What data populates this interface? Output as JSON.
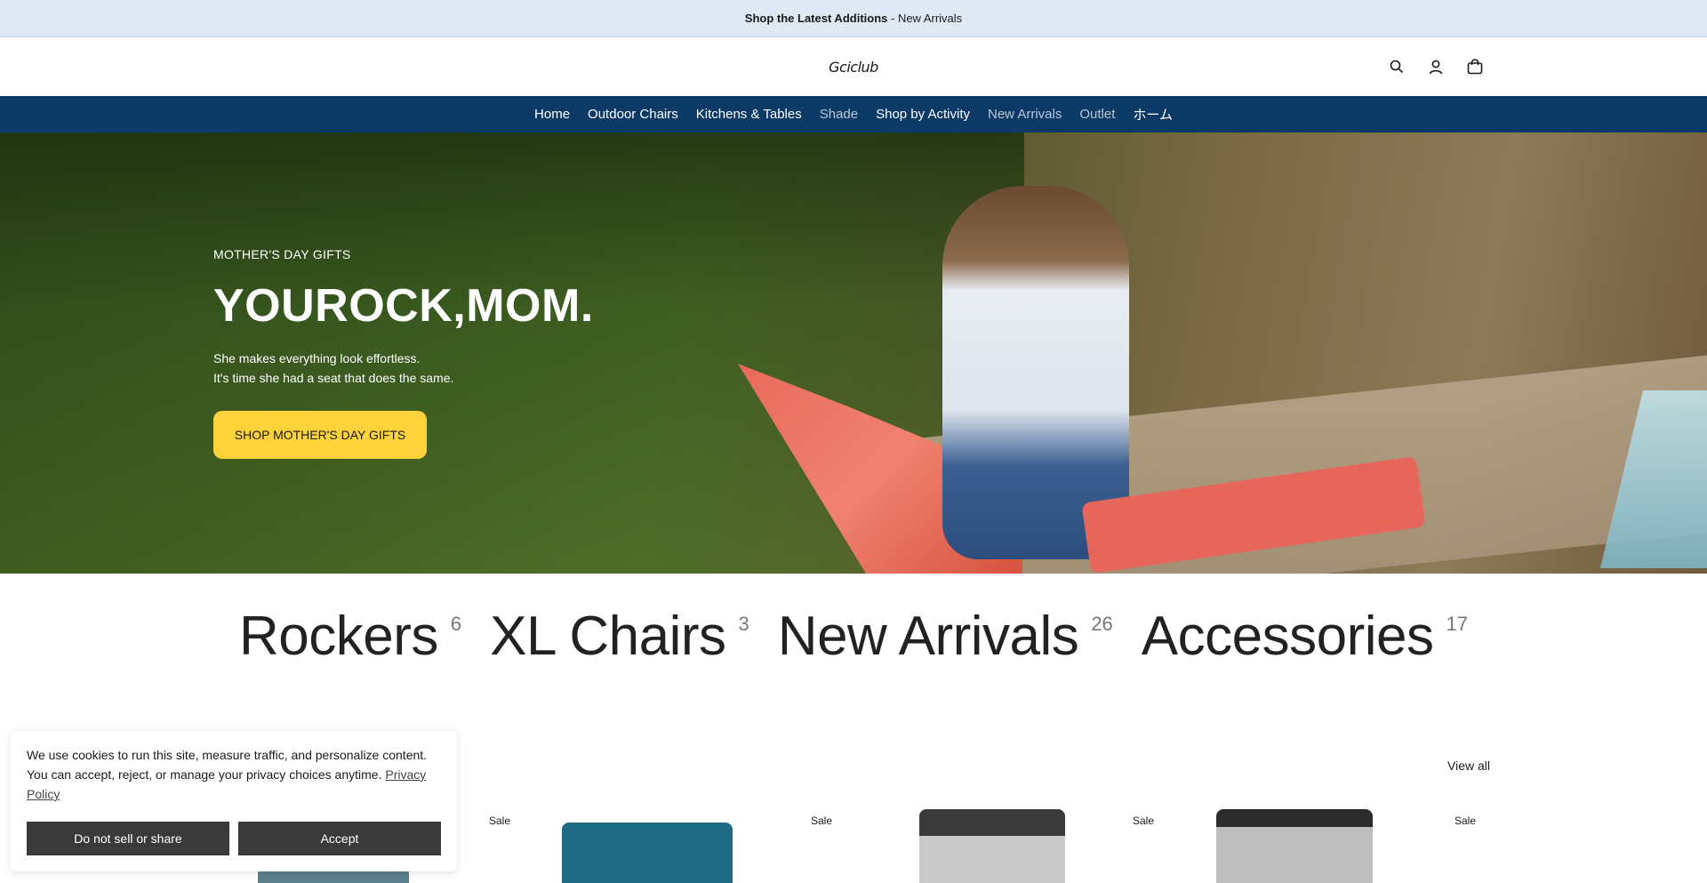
{
  "announcement": {
    "bold": "Shop the Latest Additions",
    "sep": " - ",
    "link": "New Arrivals"
  },
  "header": {
    "logo": "Gciclub",
    "icons": [
      "search-icon",
      "account-icon",
      "cart-icon"
    ]
  },
  "nav": {
    "items": [
      {
        "label": "Home"
      },
      {
        "label": "Outdoor Chairs"
      },
      {
        "label": "Kitchens & Tables"
      },
      {
        "label": "Shade"
      },
      {
        "label": "Shop by Activity"
      },
      {
        "label": "New Arrivals"
      },
      {
        "label": "Outlet"
      },
      {
        "label": "ホーム"
      }
    ]
  },
  "hero": {
    "eyebrow": "MOTHER'S DAY GIFTS",
    "title": "YOUROCK,MOM.",
    "line1": "She makes everything look effortless.",
    "line2": "It's time she had a seat that does the same.",
    "button": "SHOP MOTHER'S DAY GIFTS"
  },
  "categories": [
    {
      "name": "Rockers",
      "count": "6"
    },
    {
      "name": "XL Chairs",
      "count": "3"
    },
    {
      "name": "New Arrivals",
      "count": "26"
    },
    {
      "name": "Accessories",
      "count": "17"
    }
  ],
  "products": {
    "view_all": "View all",
    "sale_badge": "Sale"
  },
  "cookie": {
    "text": "We use cookies to run this site, measure traffic, and personalize content. You can accept, reject, or manage your privacy choices anytime.",
    "policy_link": "Privacy Policy",
    "reject": "Do not sell or share",
    "accept": "Accept"
  },
  "colors": {
    "nav_bg": "#0b3a66",
    "announce_bg": "#dfe9f3",
    "cta": "#fdd23a"
  }
}
